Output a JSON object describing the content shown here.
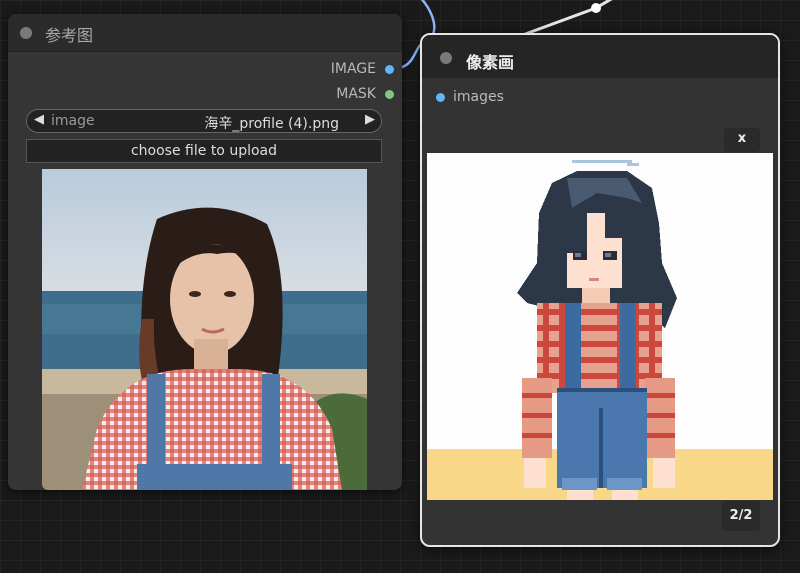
{
  "load_node": {
    "title": "参考图",
    "outputs": [
      {
        "label": "IMAGE",
        "color": "#64b5f6"
      },
      {
        "label": "MASK",
        "color": "#81c784"
      }
    ],
    "image_widget": {
      "name": "image",
      "value": "海辛_profile (4).png"
    },
    "upload_label": "choose file to upload"
  },
  "preview_node": {
    "title": "像素画",
    "input": {
      "label": "images",
      "color": "#64b5f6"
    },
    "close_label": "x",
    "counter": "2/2"
  },
  "icons": {
    "prev": "◀",
    "next": "▶"
  },
  "colors": {
    "link": "#8ab4f8",
    "selected_border": "#e6e6e6"
  }
}
